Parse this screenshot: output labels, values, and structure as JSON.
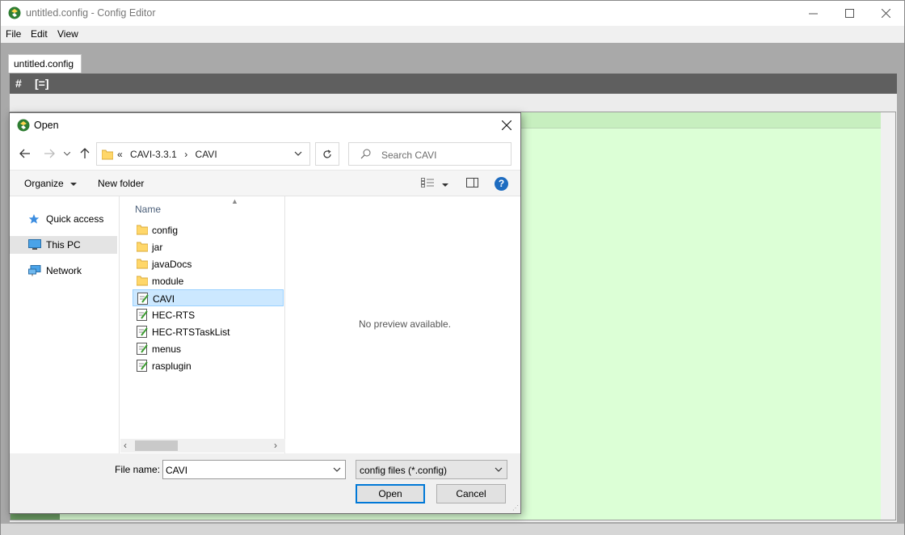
{
  "app": {
    "title": "untitled.config - Config Editor",
    "menu": [
      "File",
      "Edit",
      "View"
    ],
    "tab": "untitled.config",
    "toolbar": {
      "hash": "#",
      "bracket": "[=]"
    },
    "editor_color": "#dcffd6",
    "gutter_color": "#6b9c63"
  },
  "dialog": {
    "title": "Open",
    "address": {
      "overflow": "«",
      "parts": [
        "CAVI-3.3.1",
        "›",
        "CAVI"
      ]
    },
    "search_placeholder": "Search CAVI",
    "commands": {
      "organize": "Organize",
      "new_folder": "New folder",
      "help": "?"
    },
    "nav": [
      {
        "label": "Quick access",
        "icon": "star-icon",
        "selected": false
      },
      {
        "label": "This PC",
        "icon": "computer-icon",
        "selected": true
      },
      {
        "label": "Network",
        "icon": "network-icon",
        "selected": false
      }
    ],
    "column_header": "Name",
    "files": [
      {
        "name": "config",
        "type": "folder",
        "selected": false
      },
      {
        "name": "jar",
        "type": "folder",
        "selected": false
      },
      {
        "name": "javaDocs",
        "type": "folder",
        "selected": false
      },
      {
        "name": "module",
        "type": "folder",
        "selected": false
      },
      {
        "name": "CAVI",
        "type": "config",
        "selected": true
      },
      {
        "name": "HEC-RTS",
        "type": "config",
        "selected": false
      },
      {
        "name": "HEC-RTSTaskList",
        "type": "config",
        "selected": false
      },
      {
        "name": "menus",
        "type": "config",
        "selected": false
      },
      {
        "name": "rasplugin",
        "type": "config",
        "selected": false
      }
    ],
    "preview_message": "No preview available.",
    "file_name_label": "File name:",
    "file_name_value": "CAVI",
    "filter_value": "config files (*.config)",
    "open_label": "Open",
    "cancel_label": "Cancel",
    "accent": "#0078d7",
    "selection": "#cce8ff"
  }
}
